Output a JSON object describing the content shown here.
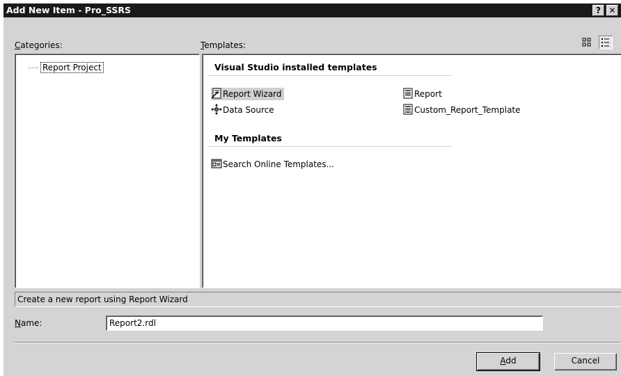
{
  "window": {
    "title": "Add New Item - Pro_SSRS",
    "help_label": "?",
    "close_label": "✕"
  },
  "view_toggle": {
    "large_icons_label": "▯▯",
    "list_label": "☰"
  },
  "categories": {
    "label": "Categories:",
    "items": [
      {
        "label": "Report Project",
        "selected": true
      }
    ]
  },
  "templates": {
    "label": "Templates:",
    "groups": [
      {
        "heading": "Visual Studio installed templates",
        "items": [
          {
            "label": "Report Wizard",
            "icon": "report-wizard-icon",
            "selected": true
          },
          {
            "label": "Report",
            "icon": "report-icon"
          },
          {
            "label": "Data Source",
            "icon": "data-source-icon"
          },
          {
            "label": "Custom_Report_Template",
            "icon": "report-template-icon"
          }
        ]
      },
      {
        "heading": "My Templates",
        "items": [
          {
            "label": "Search Online Templates...",
            "icon": "search-online-icon"
          }
        ]
      }
    ]
  },
  "status_text": "Create a new report using Report Wizard",
  "name": {
    "label": "Name:",
    "value": "Report2.rdl"
  },
  "buttons": {
    "add": "Add",
    "cancel": "Cancel"
  }
}
